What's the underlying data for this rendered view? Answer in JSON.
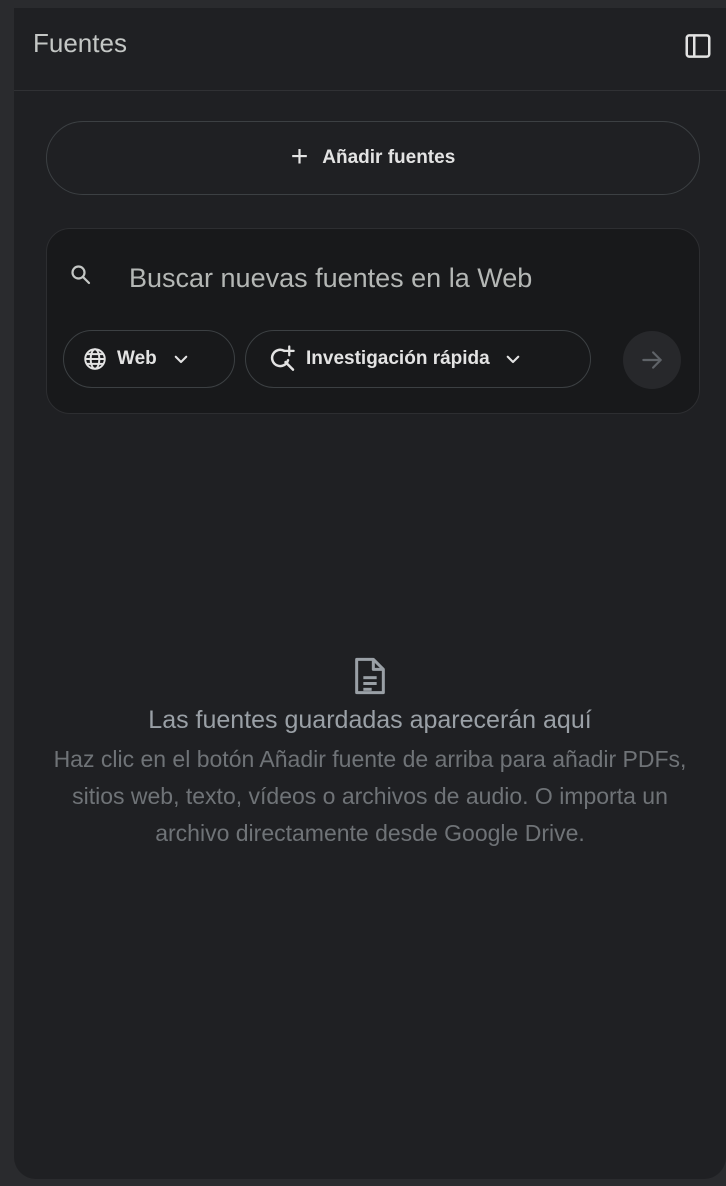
{
  "header": {
    "title": "Fuentes",
    "collapse_icon": "panel-toggle-icon"
  },
  "add_sources": {
    "label": "Añadir fuentes",
    "icon": "plus-icon"
  },
  "search": {
    "placeholder": "Buscar nuevas fuentes en la Web",
    "value": "",
    "icon": "search-icon",
    "source_chip": {
      "label": "Web",
      "icon": "globe-icon"
    },
    "mode_chip": {
      "label": "Investigación rápida",
      "icon": "sparkle-search-icon"
    },
    "submit_icon": "arrow-right-icon"
  },
  "empty_state": {
    "icon": "document-icon",
    "title": "Las fuentes guardadas aparecerán aquí",
    "description": "Haz clic en el botón Añadir fuente de arriba para añadir PDFs, sitios web, texto, vídeos o archivos de audio. O importa un archivo directamente desde Google Drive."
  },
  "colors": {
    "background": "#1f2023",
    "text_primary": "#e3e3e3",
    "text_muted": "#6f7377"
  }
}
